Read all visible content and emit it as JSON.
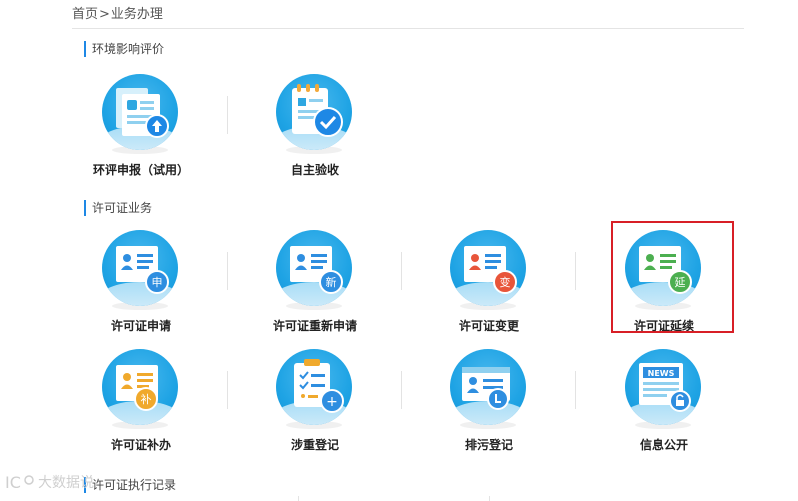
{
  "breadcrumb": {
    "home": "首页",
    "separator": ">",
    "current": "业务办理"
  },
  "sections": {
    "eia": {
      "title": "环境影响评价"
    },
    "permit": {
      "title": "许可证业务"
    },
    "execution": {
      "title": "许可证执行记录"
    }
  },
  "eia_tiles": [
    {
      "label": "环评申报（试用）",
      "icon": "upload-report-icon"
    },
    {
      "label": "自主验收",
      "icon": "checklist-approval-icon"
    }
  ],
  "permit_tiles": [
    {
      "label": "许可证申请",
      "icon": "permit-apply-icon",
      "badge": "申",
      "badge_color": "#2e8ee0"
    },
    {
      "label": "许可证重新申请",
      "icon": "permit-reapply-icon",
      "badge": "新",
      "badge_color": "#2e8ee0"
    },
    {
      "label": "许可证变更",
      "icon": "permit-change-icon",
      "badge": "变",
      "badge_color": "#e8553a"
    },
    {
      "label": "许可证延续",
      "icon": "permit-renew-icon",
      "badge": "延",
      "badge_color": "#4caf50",
      "highlighted": true
    },
    {
      "label": "许可证补办",
      "icon": "permit-reissue-icon",
      "badge": "补",
      "badge_color": "#f0a92c"
    },
    {
      "label": "涉重登记",
      "icon": "heavy-metal-registration-icon",
      "badge": "+",
      "badge_color": "#2e8ee0"
    },
    {
      "label": "排污登记",
      "icon": "discharge-registration-icon"
    },
    {
      "label": "信息公开",
      "icon": "info-disclosure-icon",
      "badge_text": "NEWS"
    }
  ],
  "watermark": {
    "text": "大数据说"
  },
  "colors": {
    "accent": "#1e88e5",
    "highlight": "#d81f26",
    "circle": "#1ea3e4"
  }
}
